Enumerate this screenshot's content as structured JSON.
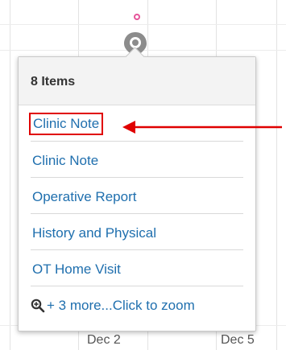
{
  "popover": {
    "title": "8 Items",
    "items": [
      {
        "label": "Clinic Note",
        "highlighted": true
      },
      {
        "label": "Clinic Note",
        "highlighted": false
      },
      {
        "label": "Operative Report",
        "highlighted": false
      },
      {
        "label": "History and Physical",
        "highlighted": false
      },
      {
        "label": "OT Home Visit",
        "highlighted": false
      }
    ],
    "more_label": "+ 3 more...Click to zoom"
  },
  "timeline": {
    "axis_labels": [
      "Dec 2",
      "Dec 5"
    ]
  },
  "colors": {
    "link": "#1f6fae",
    "annotation": "#e00000",
    "marker": "#e6559a"
  },
  "icons": {
    "zoom": "zoom-in-icon",
    "cluster": "cluster-marker-icon",
    "pin": "event-marker-icon"
  }
}
